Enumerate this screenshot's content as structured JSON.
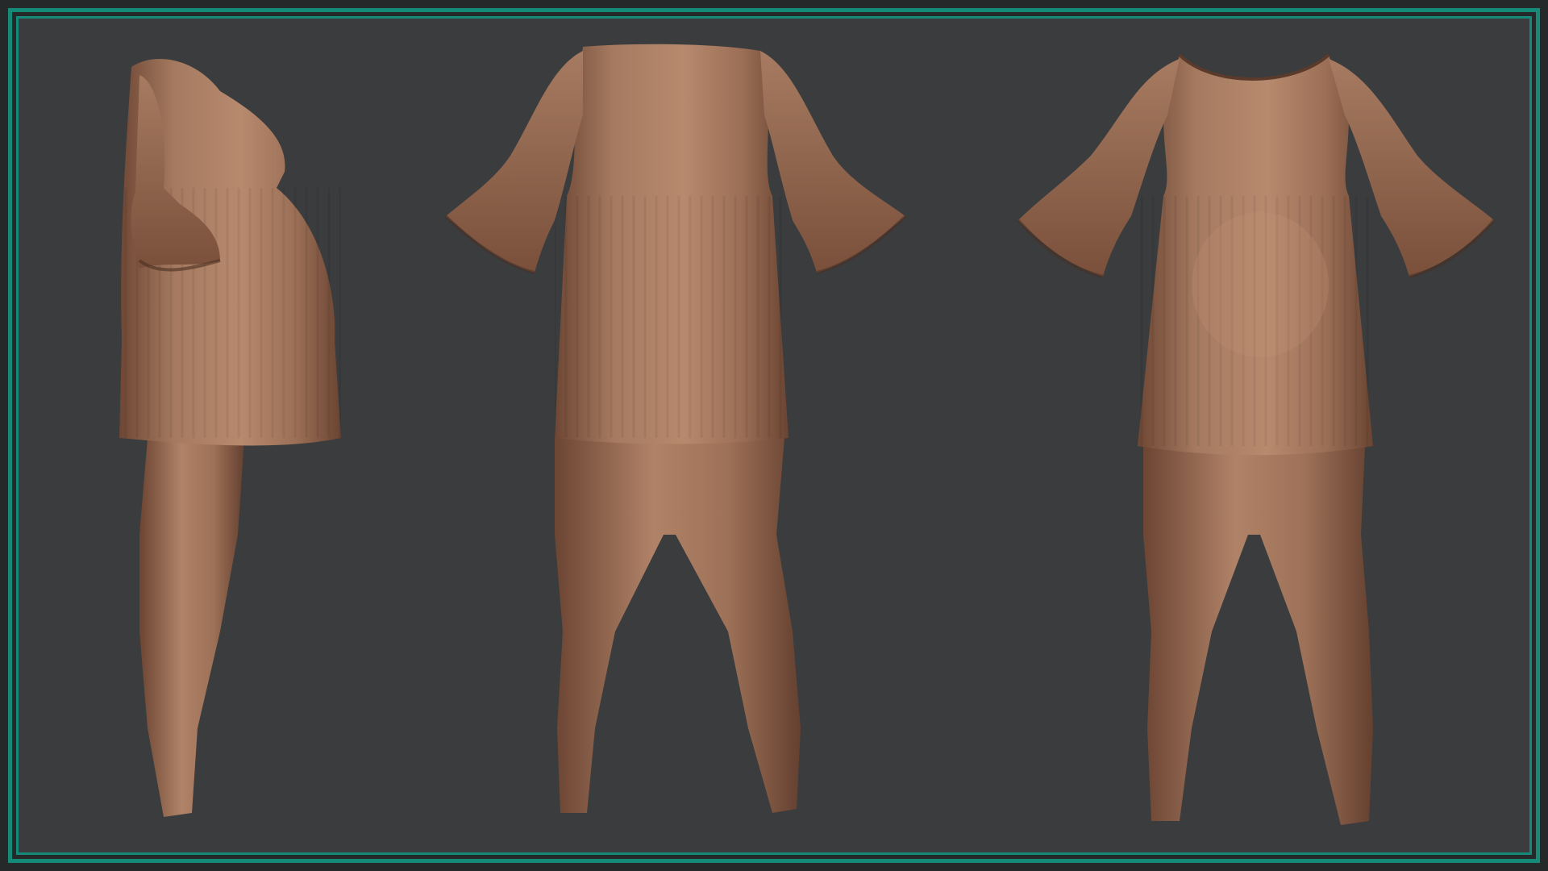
{
  "image": {
    "subject": "",
    "views": [
      "side",
      "back",
      "front"
    ]
  },
  "colors": {
    "frame_border": "#168a78",
    "background": "#3b3c3e",
    "fabric_base": "#9c6f55",
    "fabric_light": "#b98a6d",
    "fabric_shadow": "#5e3c2a"
  }
}
